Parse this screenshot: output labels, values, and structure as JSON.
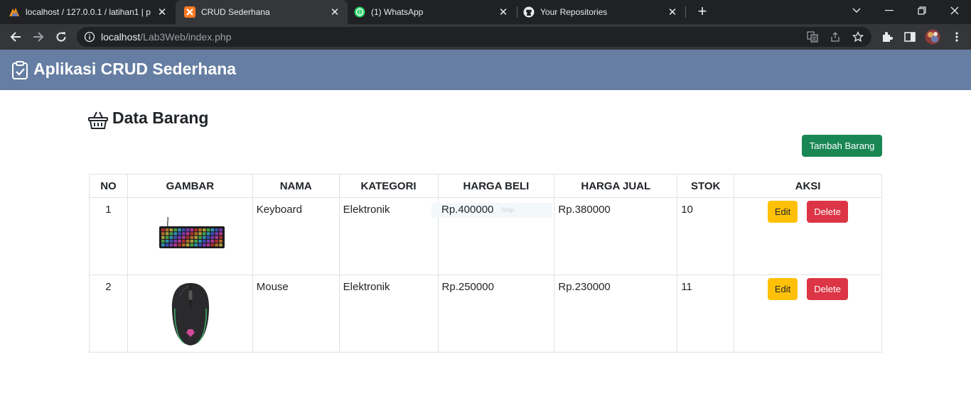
{
  "browser": {
    "tabs": [
      {
        "title": "localhost / 127.0.0.1 / latihan1 | p",
        "favicon": "phpmyadmin-icon",
        "active": false
      },
      {
        "title": "CRUD Sederhana",
        "favicon": "xampp-icon",
        "active": true
      },
      {
        "title": "(1) WhatsApp",
        "favicon": "whatsapp-icon",
        "active": false
      },
      {
        "title": "Your Repositories",
        "favicon": "github-icon",
        "active": false
      }
    ],
    "url_host": "localhost",
    "url_path": "/Lab3Web/index.php"
  },
  "app": {
    "title": "Aplikasi CRUD Sederhana",
    "icon": "clipboard-check-icon",
    "header_color": "#667ea3"
  },
  "section": {
    "title": "Data Barang",
    "icon": "basket-icon",
    "add_button": "Tambah Barang",
    "add_button_color": "#198754"
  },
  "table": {
    "headers": [
      "NO",
      "GAMBAR",
      "NAMA",
      "KATEGORI",
      "HARGA BELI",
      "HARGA JUAL",
      "STOK",
      "AKSI"
    ],
    "rows": [
      {
        "no": "1",
        "image": "keyboard-image",
        "nama": "Keyboard",
        "kategori": "Elektronik",
        "harga_beli": "Rp.400000",
        "harga_jual": "Rp.380000",
        "stok": "10"
      },
      {
        "no": "2",
        "image": "mouse-image",
        "nama": "Mouse",
        "kategori": "Elektronik",
        "harga_beli": "Rp.250000",
        "harga_jual": "Rp.230000",
        "stok": "11"
      }
    ],
    "edit_label": "Edit",
    "delete_label": "Delete",
    "edit_color": "#ffc107",
    "delete_color": "#dc3545"
  },
  "overlay": {
    "snip_label": "Snip"
  }
}
